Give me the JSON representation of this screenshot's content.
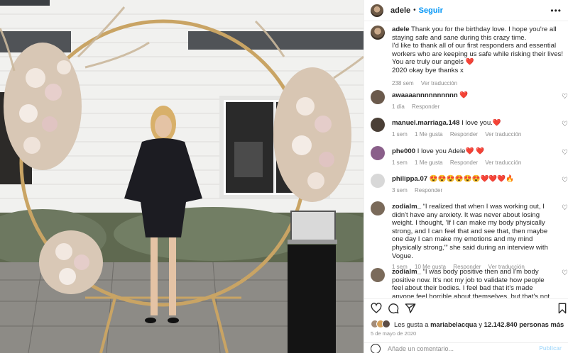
{
  "post": {
    "username": "adele",
    "follow_label": "Seguir",
    "more_icon": "more-horizontal-icon",
    "caption": {
      "username": "adele",
      "text": "Thank you for the birthday love. I hope you're all staying safe and sane during this crazy time.",
      "text2": "I'd like to thank all of our first responders and essential workers who are keeping us safe while risking their lives! You are truly our angels ❤️",
      "text3": "2020 okay bye thanks x",
      "time": "238 sem",
      "translate": "Ver traducción"
    },
    "comments": [
      {
        "username": "awaaaannnnnnnnnn",
        "text": "❤️",
        "time": "1 día",
        "reply": "Responder",
        "likes": "",
        "translate": "",
        "avatar_color": "#6b5a4c"
      },
      {
        "username": "manuel.marriaga.148",
        "text": "I love you.❤️",
        "time": "1 sem",
        "likes": "1 Me gusta",
        "reply": "Responder",
        "translate": "Ver traducción",
        "avatar_color": "#4a3f36"
      },
      {
        "username": "phe000",
        "text": "I love you Adele❤️ ❤️",
        "time": "1 sem",
        "likes": "1 Me gusta",
        "reply": "Responder",
        "translate": "Ver traducción",
        "avatar_color": "#8a5f8a"
      },
      {
        "username": "philippa.07",
        "text": "😍😍😍😍😍😍❤️❤️❤️🔥",
        "time": "3 sem",
        "likes": "",
        "reply": "Responder",
        "translate": "",
        "avatar_color": "#d8d8d8"
      },
      {
        "username": "zodialm_",
        "text": "“I realized that when I was working out, I didn't have any anxiety. It was never about losing weight. I thought, 'If I can make my body physically strong, and I can feel that and see that, then maybe one day I can make my emotions and my mind physically strong,'” she said during an interview with Vogue.",
        "time": "1 sem",
        "likes": "10 Me gusta",
        "reply": "Responder",
        "translate": "Ver traducción",
        "avatar_color": "#7a6a5a"
      },
      {
        "username": "zodialm_",
        "text": "“I was body positive then and I'm body positive now. It's not my job to validate how people feel about their bodies. I feel bad that it's made anyone feel horrible about themselves, but that's not my job.”",
        "time": "",
        "likes": "",
        "reply": "",
        "translate": "",
        "avatar_color": "#7a6a5a"
      }
    ],
    "likes_line": {
      "prefix": "Les gusta a",
      "user": "mariabelacqua",
      "middle": "y",
      "count": "12.142.840 personas más"
    },
    "date": "5 de mayo de 2020",
    "add_comment_placeholder": "Añade un comentario...",
    "publish_label": "Publicar",
    "icons": {
      "like": "heart-icon",
      "comment": "comment-icon",
      "share": "share-icon",
      "save": "bookmark-icon",
      "comment_like": "heart-small-icon"
    }
  },
  "colors": {
    "accent": "#0095f6",
    "heart": "#ed4956",
    "secondary_text": "#8e8e8e"
  }
}
